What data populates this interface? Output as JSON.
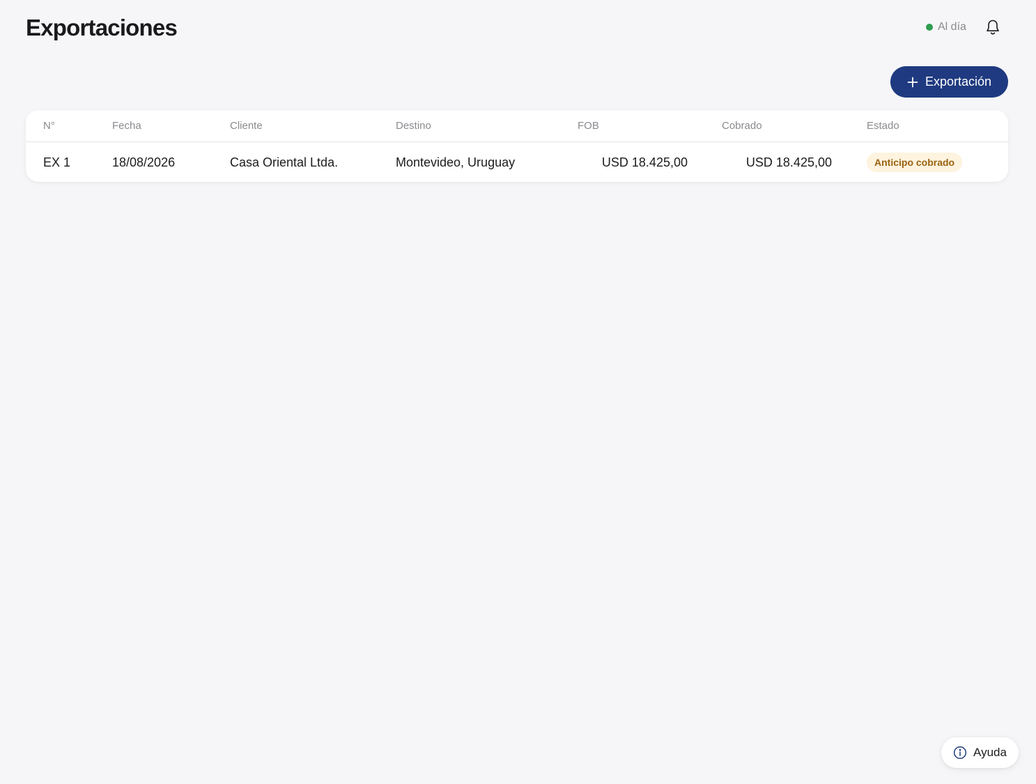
{
  "header": {
    "title": "Exportaciones",
    "status_text": "Al día",
    "status_color": "#2e9e4f",
    "notifications_icon": "bell-icon"
  },
  "actions": {
    "add_label": "Exportación",
    "add_icon": "plus-icon",
    "accent_color": "#1f3a80"
  },
  "table": {
    "columns": [
      "N°",
      "Fecha",
      "Cliente",
      "Destino",
      "FOB",
      "Cobrado",
      "Estado"
    ],
    "rows": [
      {
        "numero": "EX 1",
        "fecha": "18/08/2026",
        "cliente": "Casa Oriental Ltda.",
        "destino": "Montevideo, Uruguay",
        "fob": "USD 18.425,00",
        "cobrado": "USD 18.425,00",
        "estado": "Anticipo cobrado"
      }
    ]
  },
  "help": {
    "label": "Ayuda",
    "icon": "info-icon"
  }
}
